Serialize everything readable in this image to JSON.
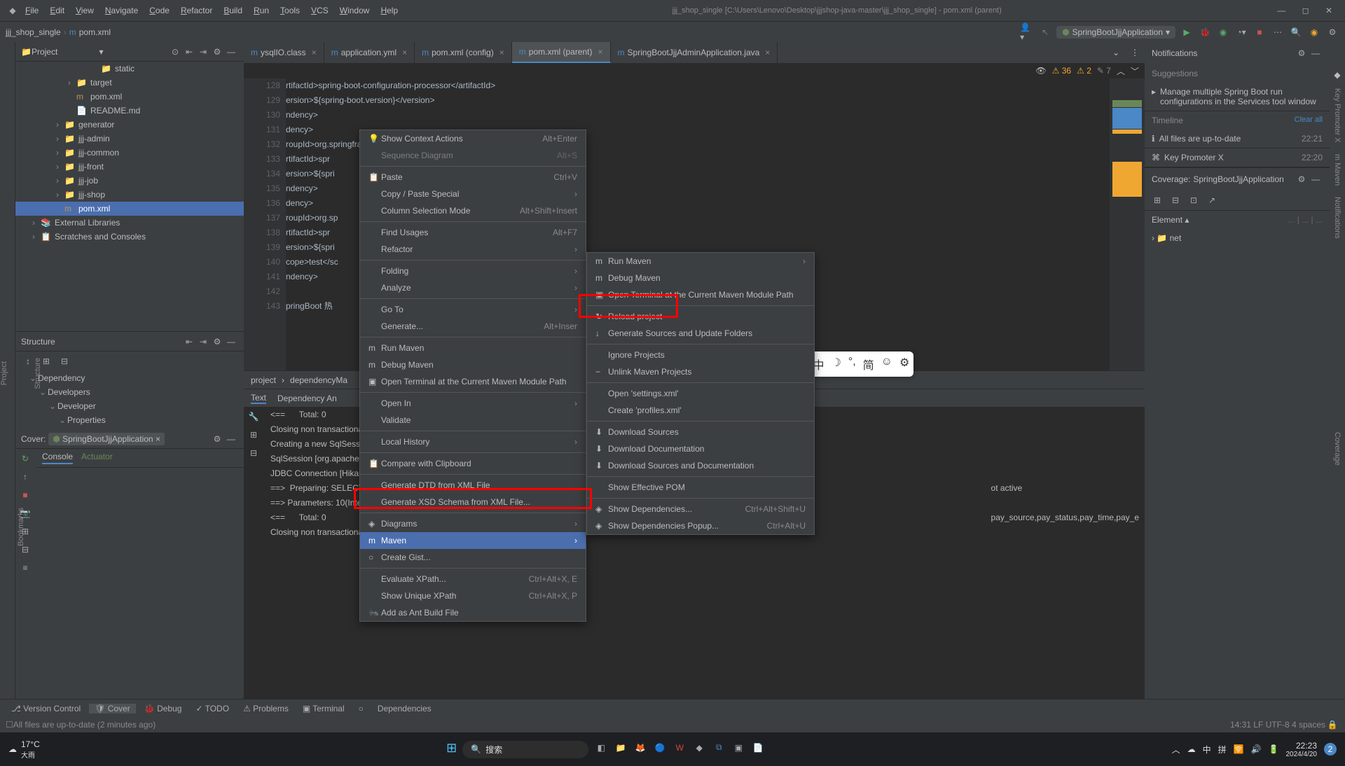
{
  "titlebar": {
    "menus": [
      "File",
      "Edit",
      "View",
      "Navigate",
      "Code",
      "Refactor",
      "Build",
      "Run",
      "Tools",
      "VCS",
      "Window",
      "Help"
    ],
    "title": "jjj_shop_single [C:\\Users\\Lenovo\\Desktop\\jjjshop-java-master\\jjj_shop_single] - pom.xml (parent)"
  },
  "breadcrumb": {
    "project": "jjj_shop_single",
    "file": "pom.xml"
  },
  "runConfig": "SpringBootJjjApplication",
  "projectTree": {
    "title": "Project",
    "items": [
      {
        "label": "static",
        "indent": 110,
        "icon": "📁",
        "arrow": ""
      },
      {
        "label": "target",
        "indent": 75,
        "icon": "📁",
        "arrow": "›"
      },
      {
        "label": "pom.xml",
        "indent": 75,
        "icon": "m",
        "arrow": ""
      },
      {
        "label": "README.md",
        "indent": 75,
        "icon": "📄",
        "arrow": ""
      },
      {
        "label": "generator",
        "indent": 58,
        "icon": "📁",
        "arrow": "›"
      },
      {
        "label": "jjj-admin",
        "indent": 58,
        "icon": "📁",
        "arrow": "›"
      },
      {
        "label": "jjj-common",
        "indent": 58,
        "icon": "📁",
        "arrow": "›"
      },
      {
        "label": "jjj-front",
        "indent": 58,
        "icon": "📁",
        "arrow": "›"
      },
      {
        "label": "jjj-job",
        "indent": 58,
        "icon": "📁",
        "arrow": "›"
      },
      {
        "label": "jjj-shop",
        "indent": 58,
        "icon": "📁",
        "arrow": "›"
      },
      {
        "label": "pom.xml",
        "indent": 58,
        "icon": "m",
        "arrow": "",
        "selected": true
      },
      {
        "label": "External Libraries",
        "indent": 24,
        "icon": "📚",
        "arrow": "›"
      },
      {
        "label": "Scratches and Consoles",
        "indent": 24,
        "icon": "📋",
        "arrow": "›"
      }
    ]
  },
  "structure": {
    "title": "Structure",
    "items": [
      "Dependency",
      "Developers",
      "Developer",
      "Properties"
    ]
  },
  "editorTabs": [
    {
      "label": "ysqlIO.class"
    },
    {
      "label": "application.yml"
    },
    {
      "label": "pom.xml (config)"
    },
    {
      "label": "pom.xml (parent)",
      "active": true
    },
    {
      "label": "SpringBootJjjAdminApplication.java"
    }
  ],
  "warnings": {
    "a": "36",
    "b": "2",
    "c": "7"
  },
  "code": {
    "startLine": 128,
    "lines": [
      "rtifactId>spring-boot-configuration-processor</artifactId>",
      "ersion>${spring-boot.version}</version>",
      "ndency>",
      "dency>",
      "roupId>org.springframework.boot</groupId>",
      "rtifactId>spr",
      "ersion>${spri",
      "ndency>",
      "dency>",
      "roupId>org.sp",
      "rtifactId>spr",
      "ersion>${spri",
      "cope>test</sc",
      "ndency>",
      "",
      "pringBoot 热"
    ]
  },
  "editorBreadcrumb": {
    "a": "project",
    "b": "dependencyMa"
  },
  "editorBottomTabs": [
    "Text",
    "Dependency An"
  ],
  "coverPanel": {
    "title": "Cover:",
    "app": "SpringBootJjjApplication"
  },
  "consoleTabs": [
    "Console",
    "Actuator"
  ],
  "console": [
    "<==      Total: 0",
    "Closing non transactional SqlSession [org.apache.ibatis.",
    "Creating a new SqlSession",
    "SqlSession [org.apache.ibatis.session.defaults.DefaultSq",
    "JDBC Connection [HikariProxyConnection@1653887914 wrappi",
    "==>  Preparing: SELECT order_id,order_no,trade_no,total_",
    "==> Parameters: 10(Integer), 10(Integer), 0(Integer), 80",
    "<==      Total: 0",
    "Closing non transactional SqlSession [org.apache.ibatis."
  ],
  "consoleRight": [
    "ot active",
    "pay_source,pay_status,pay_time,pay_e"
  ],
  "notifications": {
    "header": "Notifications",
    "suggestions": "Suggestions",
    "suggestion": "Manage multiple Spring Boot run configurations in the Services tool window",
    "timeline": "Timeline",
    "clearAll": "Clear all",
    "items": [
      {
        "icon": "ℹ",
        "text": "All files are up-to-date",
        "time": "22:21"
      },
      {
        "icon": "⌘",
        "text": "Key Promoter X",
        "time": "22:20"
      }
    ],
    "coverage": "Coverage:",
    "coverageApp": "SpringBootJjjApplication",
    "element": "Element",
    "net": "net"
  },
  "contextMenu1": [
    {
      "label": "Show Context Actions",
      "shortcut": "Alt+Enter",
      "icon": "💡"
    },
    {
      "label": "Sequence Diagram",
      "shortcut": "Alt+S",
      "disabled": true
    },
    {
      "sep": true
    },
    {
      "label": "Paste",
      "shortcut": "Ctrl+V",
      "icon": "📋"
    },
    {
      "label": "Copy / Paste Special",
      "sub": true
    },
    {
      "label": "Column Selection Mode",
      "shortcut": "Alt+Shift+Insert"
    },
    {
      "sep": true
    },
    {
      "label": "Find Usages",
      "shortcut": "Alt+F7"
    },
    {
      "label": "Refactor",
      "sub": true
    },
    {
      "sep": true
    },
    {
      "label": "Folding",
      "sub": true
    },
    {
      "label": "Analyze",
      "sub": true
    },
    {
      "sep": true
    },
    {
      "label": "Go To",
      "sub": true
    },
    {
      "label": "Generate...",
      "shortcut": "Alt+Inser"
    },
    {
      "sep": true
    },
    {
      "label": "Run Maven",
      "icon": "m"
    },
    {
      "label": "Debug Maven",
      "icon": "m"
    },
    {
      "label": "Open Terminal at the Current Maven Module Path",
      "icon": "▣"
    },
    {
      "sep": true
    },
    {
      "label": "Open In",
      "sub": true
    },
    {
      "label": "Validate"
    },
    {
      "sep": true
    },
    {
      "label": "Local History",
      "sub": true
    },
    {
      "sep": true
    },
    {
      "label": "Compare with Clipboard",
      "icon": "📋"
    },
    {
      "sep": true
    },
    {
      "label": "Generate DTD from XML File"
    },
    {
      "label": "Generate XSD Schema from XML File..."
    },
    {
      "sep": true
    },
    {
      "label": "Diagrams",
      "sub": true,
      "icon": "◈"
    },
    {
      "label": "Maven",
      "sub": true,
      "icon": "m",
      "hovered": true
    },
    {
      "label": "Create Gist...",
      "icon": "○"
    },
    {
      "sep": true
    },
    {
      "label": "Evaluate XPath...",
      "shortcut": "Ctrl+Alt+X, E"
    },
    {
      "label": "Show Unique XPath",
      "shortcut": "Ctrl+Alt+X, P"
    },
    {
      "label": "Add as Ant Build File",
      "icon": "🐜"
    }
  ],
  "contextMenu2": [
    {
      "label": "Run Maven",
      "icon": "m",
      "sub": true
    },
    {
      "label": "Debug Maven",
      "icon": "m"
    },
    {
      "label": "Open Terminal at the Current Maven Module Path",
      "icon": "▣"
    },
    {
      "sep": true
    },
    {
      "label": "Reload project",
      "icon": "↻"
    },
    {
      "label": "Generate Sources and Update Folders",
      "icon": "↓"
    },
    {
      "sep": true
    },
    {
      "label": "Ignore Projects"
    },
    {
      "label": "Unlink Maven Projects",
      "icon": "−"
    },
    {
      "sep": true
    },
    {
      "label": "Open 'settings.xml'"
    },
    {
      "label": "Create 'profiles.xml'"
    },
    {
      "sep": true
    },
    {
      "label": "Download Sources",
      "icon": "⬇"
    },
    {
      "label": "Download Documentation",
      "icon": "⬇"
    },
    {
      "label": "Download Sources and Documentation",
      "icon": "⬇"
    },
    {
      "sep": true
    },
    {
      "label": "Show Effective POM"
    },
    {
      "sep": true
    },
    {
      "label": "Show Dependencies...",
      "shortcut": "Ctrl+Alt+Shift+U",
      "icon": "◈"
    },
    {
      "label": "Show Dependencies Popup...",
      "shortcut": "Ctrl+Alt+U",
      "icon": "◈"
    }
  ],
  "bottomTabs": [
    {
      "icon": "⎇",
      "label": "Version Control"
    },
    {
      "icon": "🛡",
      "label": "Cover",
      "active": true
    },
    {
      "icon": "🐞",
      "label": "Debug"
    },
    {
      "icon": "✓",
      "label": "TODO"
    },
    {
      "icon": "⚠",
      "label": "Problems"
    },
    {
      "icon": "▣",
      "label": "Terminal"
    },
    {
      "icon": "○",
      "label": ""
    },
    {
      "icon": "",
      "label": "Dependencies"
    }
  ],
  "statusBar": {
    "left": "All files are up-to-date (2 minutes ago)",
    "right": "14:31  LF  UTF-8  4 spaces"
  },
  "taskbar": {
    "weather": {
      "temp": "17°C",
      "cond": "大雨"
    },
    "search": "搜索",
    "time": "22:23",
    "date": "2024/4/20"
  },
  "ime": [
    "I",
    "中",
    "☽",
    "°,",
    "简",
    "☺",
    "⚙"
  ]
}
